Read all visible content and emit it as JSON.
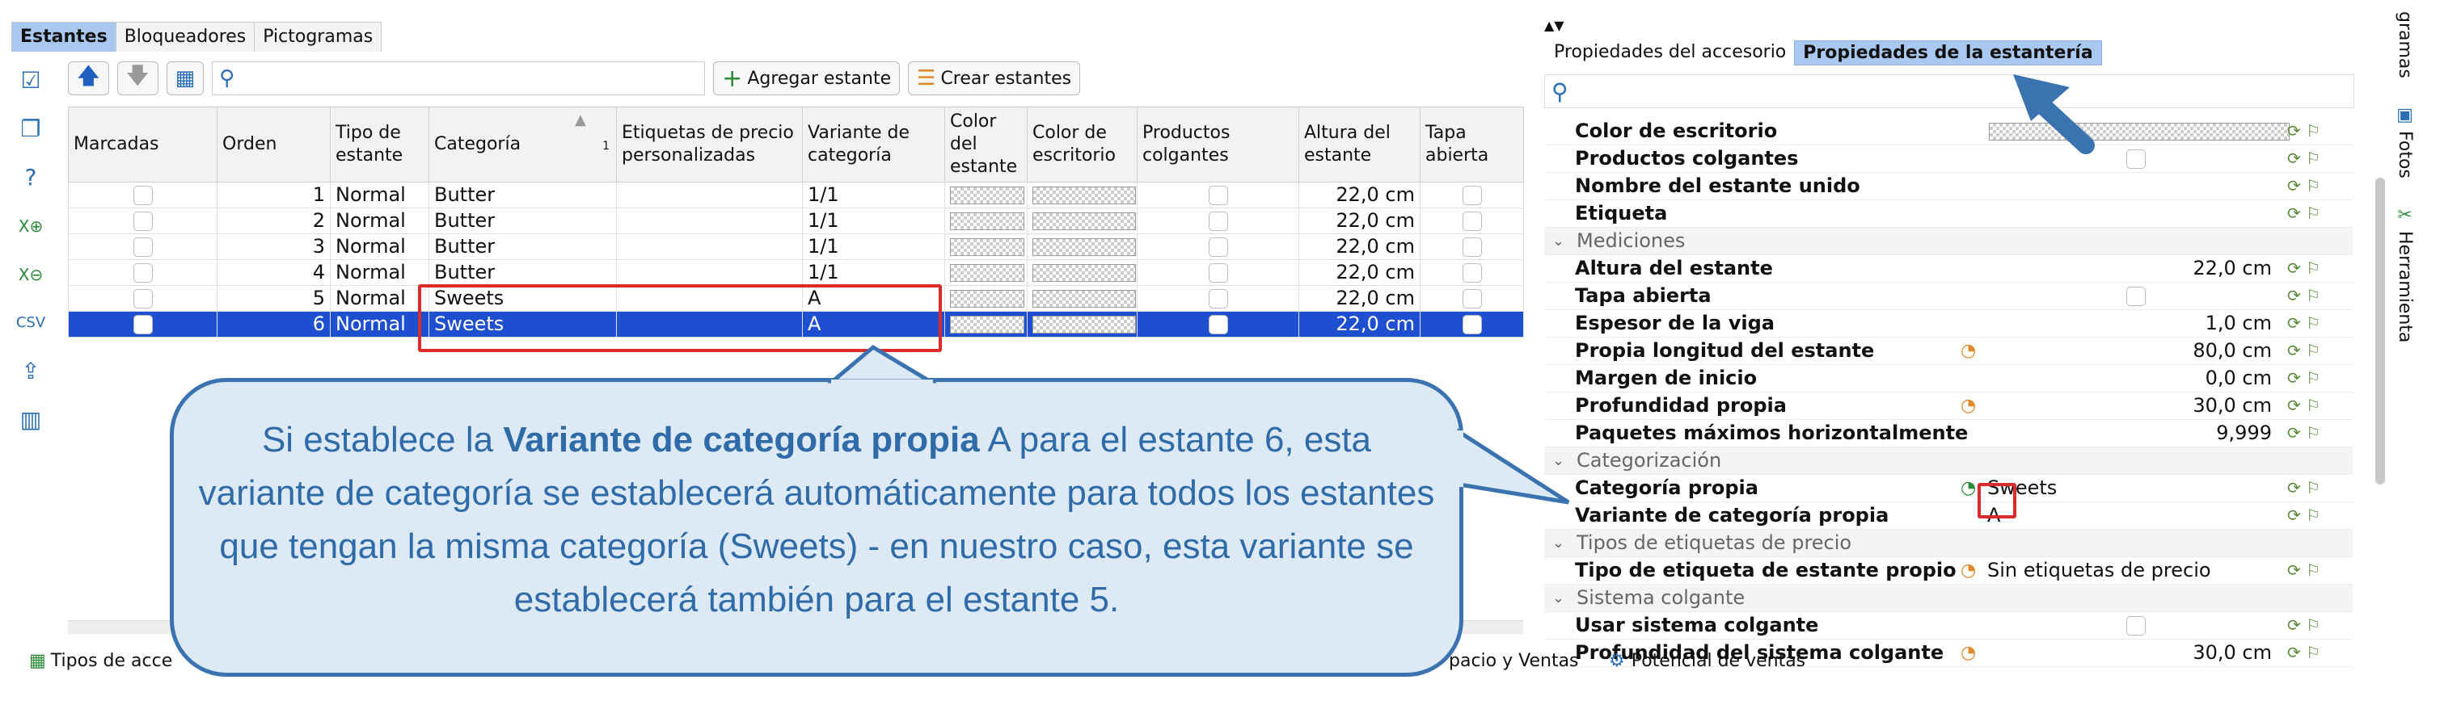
{
  "left_tabs": [
    "Estantes",
    "Bloqueadores",
    "Pictogramas"
  ],
  "toolbar": {
    "add_label": "Agregar estante",
    "create_label": "Crear estantes"
  },
  "columns": [
    "Marcadas",
    "Orden",
    "Tipo de estante",
    "Categoría",
    "Etiquetas de precio personalizadas",
    "Variante de categoría",
    "Color del estante",
    "Color de escritorio",
    "Productos colgantes",
    "Altura del estante",
    "Tapa abierta"
  ],
  "sort_indicator": "1",
  "rows": [
    {
      "order": "1",
      "type": "Normal",
      "category": "Butter",
      "variant": "1/1",
      "height": "22,0 cm"
    },
    {
      "order": "2",
      "type": "Normal",
      "category": "Butter",
      "variant": "1/1",
      "height": "22,0 cm"
    },
    {
      "order": "3",
      "type": "Normal",
      "category": "Butter",
      "variant": "1/1",
      "height": "22,0 cm"
    },
    {
      "order": "4",
      "type": "Normal",
      "category": "Butter",
      "variant": "1/1",
      "height": "22,0 cm"
    },
    {
      "order": "5",
      "type": "Normal",
      "category": "Sweets",
      "variant": "A",
      "height": "22,0 cm"
    },
    {
      "order": "6",
      "type": "Normal",
      "category": "Sweets",
      "variant": "A",
      "height": "22,0 cm"
    }
  ],
  "right_tabs": [
    "Propiedades del accesorio",
    "Propiedades de la estantería"
  ],
  "props": [
    {
      "name": "Color de escritorio",
      "kind": "pattern"
    },
    {
      "name": "Productos colgantes",
      "kind": "checkbox"
    },
    {
      "name": "Nombre del estante unido",
      "kind": "empty"
    },
    {
      "name": "Etiqueta",
      "kind": "empty"
    },
    {
      "section": "Mediciones"
    },
    {
      "name": "Altura del estante",
      "value": "22,0 cm"
    },
    {
      "name": "Tapa abierta",
      "kind": "checkbox"
    },
    {
      "name": "Espesor de la viga",
      "value": "1,0 cm"
    },
    {
      "name": "Propia longitud del estante",
      "value": "80,0 cm",
      "orange": true
    },
    {
      "name": "Margen de inicio",
      "value": "0,0 cm"
    },
    {
      "name": "Profundidad propia",
      "value": "30,0 cm",
      "orange": true
    },
    {
      "name": "Paquetes máximos horizontalmente",
      "value": "9,999"
    },
    {
      "section": "Categorización"
    },
    {
      "name": "Categoría propia",
      "left_value": "Sweets"
    },
    {
      "name": "Variante de categoría propia",
      "left_value": "A"
    },
    {
      "section": "Tipos de etiquetas de precio"
    },
    {
      "name": "Tipo de etiqueta de estante propio",
      "left_value": "Sin etiquetas de precio",
      "orange": true
    },
    {
      "section": "Sistema colgante"
    },
    {
      "name": "Usar sistema colgante",
      "kind": "checkbox"
    },
    {
      "name": "Profundidad del sistema colgante",
      "value": "30,0 cm",
      "orange": true
    }
  ],
  "side_tabs": [
    "gramas",
    "Fotos",
    "Herramienta"
  ],
  "bottom": {
    "left_tab": "Tipos de acce",
    "mid_tab": "pacio y Ventas",
    "right_tab": "Potencial de ventas"
  },
  "callout": {
    "pre": "Si establece la ",
    "bold": "Variante de categoría propia",
    "post": " A para el estante 6, esta variante de categoría se establecerá automáticamente para todos los estantes que tengan la misma categoría (Sweets) - en nuestro caso, esta variante se establecerá también para el estante 5."
  }
}
